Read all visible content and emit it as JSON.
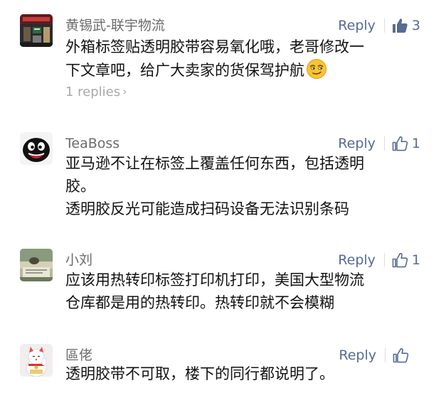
{
  "comments": [
    {
      "author": "黄锡武-联宇物流",
      "reply_label": "Reply",
      "likes": "3",
      "liked": true,
      "avatar_icon": "storefront-photo-avatar",
      "lines": [
        "外箱标签贴透明胶带容易氧化哦，老哥修改一",
        "下文章吧，给广大卖家的货保驾护航"
      ],
      "emoji_icon": "smirk-emoji-icon",
      "replies_label": "1 replies"
    },
    {
      "author": "TeaBoss",
      "reply_label": "Reply",
      "likes": "1",
      "liked": false,
      "avatar_icon": "black-face-cartoon-avatar",
      "lines": [
        "亚马逊不让在标签上覆盖任何东西，包括透明",
        "胶。",
        "透明胶反光可能造成扫码设备无法识别条码"
      ]
    },
    {
      "author": "小刘",
      "reply_label": "Reply",
      "likes": "1",
      "liked": false,
      "avatar_icon": "reading-photo-avatar",
      "lines": [
        "应该用热转印标签打印机打印，美国大型物流",
        "仓库都是用的热转印。热转印就不会模糊"
      ]
    },
    {
      "author": "區佬",
      "reply_label": "Reply",
      "liked": false,
      "avatar_icon": "lucky-cat-avatar",
      "lines": [
        "透明胶带不可取，楼下的同行都说明了。"
      ]
    }
  ],
  "colors": {
    "link": "#576b95",
    "name": "#6b6b6b",
    "text": "#111111",
    "muted": "#a9a9a9"
  }
}
